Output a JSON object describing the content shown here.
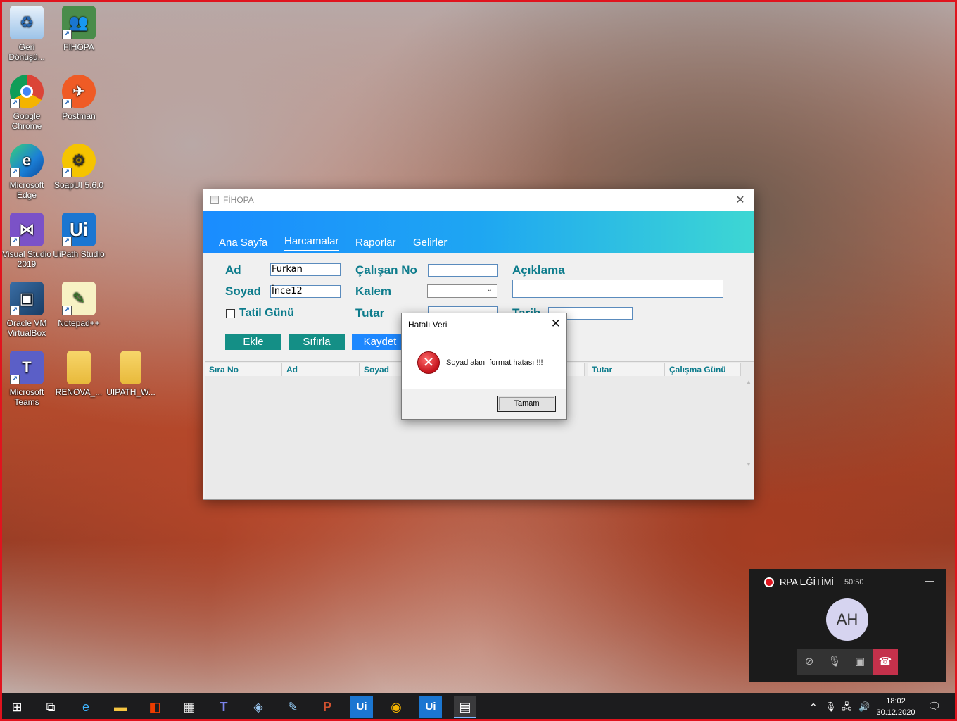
{
  "desktop": {
    "icons": [
      {
        "label": "Geri Dönüşü...",
        "icon": "recycle-bin-icon"
      },
      {
        "label": "FIHOPA",
        "icon": "users-icon"
      },
      {
        "label": "Google Chrome",
        "icon": "chrome-icon"
      },
      {
        "label": "Postman",
        "icon": "postman-icon"
      },
      {
        "label": "Microsoft Edge",
        "icon": "edge-icon"
      },
      {
        "label": "SoapUI 5.6.0",
        "icon": "soapui-icon"
      },
      {
        "label": "Visual Studio 2019",
        "icon": "visual-studio-icon"
      },
      {
        "label": "UiPath Studio",
        "icon": "uipath-icon"
      },
      {
        "label": "Oracle VM VirtualBox",
        "icon": "virtualbox-icon"
      },
      {
        "label": "Notepad++",
        "icon": "notepad-plus-icon"
      },
      {
        "label": "Microsoft Teams",
        "icon": "teams-icon"
      },
      {
        "label": "RENOVA_...",
        "icon": "folder-icon"
      },
      {
        "label": "UIPATH_W...",
        "icon": "folder-icon"
      }
    ]
  },
  "window": {
    "title": "FİHOPA",
    "tabs": [
      "Ana Sayfa",
      "Harcamalar",
      "Raporlar",
      "Gelirler"
    ],
    "active_tab": "Harcamalar",
    "form": {
      "ad_label": "Ad",
      "ad_value": "Furkan",
      "soyad_label": "Soyad",
      "soyad_value": "İnce12",
      "tatil_label": "Tatil Günü",
      "calisan_label": "Çalışan No",
      "calisan_value": "",
      "kalem_label": "Kalem",
      "kalem_value": "",
      "tutar_label": "Tutar",
      "tutar_value": "",
      "aciklama_label": "Açıklama",
      "aciklama_value": "",
      "tarih_label": "Tarih",
      "tarih_value": ""
    },
    "buttons": {
      "ekle": "Ekle",
      "sifirla": "Sıfırla",
      "kaydet": "Kaydet"
    },
    "grid_columns": [
      "Sıra No",
      "Ad",
      "Soyad",
      "",
      "",
      "Tutar",
      "Çalışma Günü"
    ]
  },
  "dialog": {
    "title": "Hatalı Veri",
    "message": "Soyad alanı format hatası !!!",
    "ok_label": "Tamam",
    "icon": "error-icon"
  },
  "call": {
    "title": "RPA EĞİTİMİ",
    "timer": "50:50",
    "avatar_initials": "AH"
  },
  "taskbar": {
    "time": "18:02",
    "date": "30.12.2020",
    "pinned": [
      "start-icon",
      "task-view-icon",
      "edge-icon",
      "file-explorer-icon",
      "office-icon",
      "store-icon",
      "teams-icon",
      "virtualbox-icon",
      "notepad-icon",
      "powerpoint-icon",
      "uipath-icon",
      "chrome-icon",
      "uipath-icon",
      "fihopa-app-icon"
    ]
  }
}
